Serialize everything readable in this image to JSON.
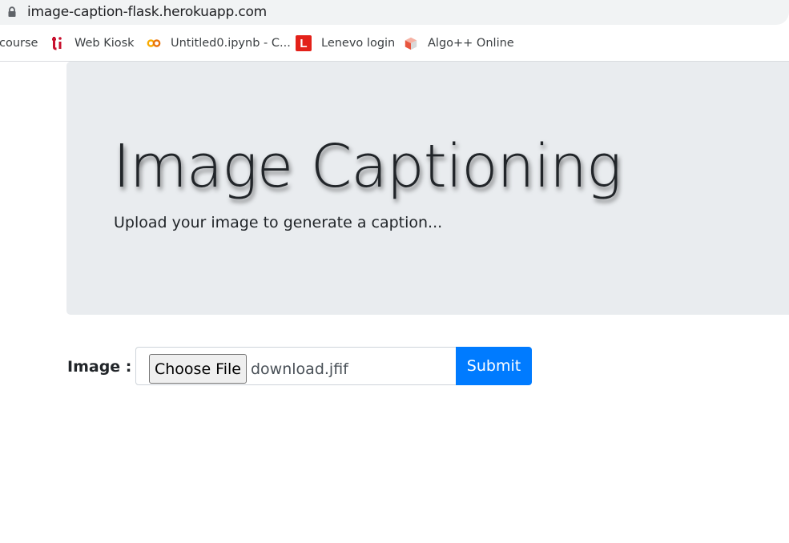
{
  "browser": {
    "url": "image-caption-flask.herokuapp.com",
    "bookmarks": [
      {
        "label": "course",
        "icon": "none"
      },
      {
        "label": "Web Kiosk",
        "icon": "ti-logo-icon"
      },
      {
        "label": "Untitled0.ipynb - C...",
        "icon": "colab-icon"
      },
      {
        "label": "Lenevo login",
        "icon": "l-logo-icon"
      },
      {
        "label": "Algo++ Online",
        "icon": "cube-icon"
      }
    ]
  },
  "jumbotron": {
    "title": "Image Captioning",
    "lead": "Upload your image to generate a caption..."
  },
  "form": {
    "label": "Image :",
    "choose_button": "Choose File",
    "filename": "download.jfif",
    "submit_label": "Submit"
  },
  "colors": {
    "primary": "#007bff",
    "jumbotron_bg": "#e9ecef",
    "text": "#212529"
  }
}
